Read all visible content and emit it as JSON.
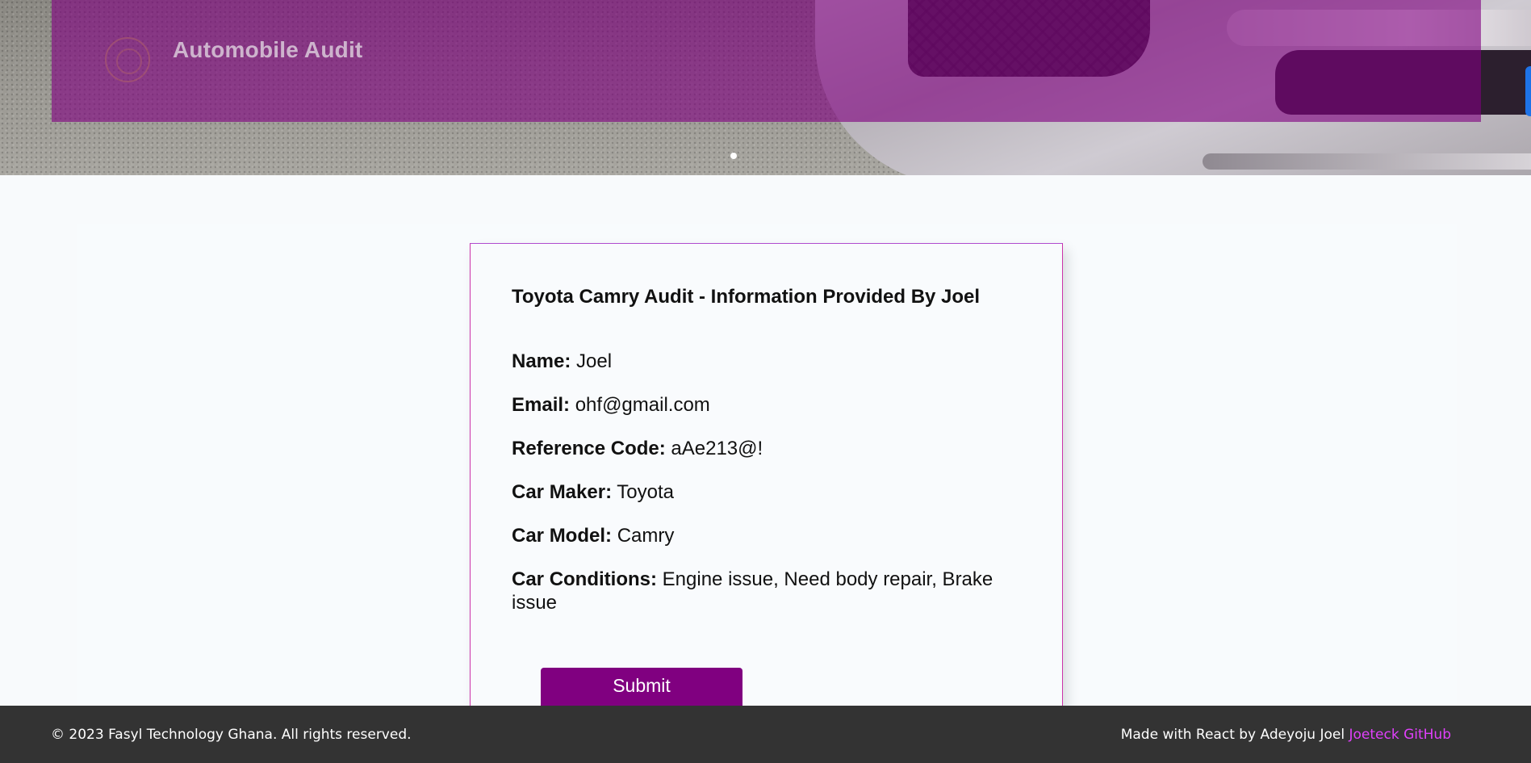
{
  "header": {
    "brand_title": "Automobile Audit",
    "logo_icon": "circle-logo-icon",
    "carousel": {
      "indicator_count": 1,
      "active_index": 0
    }
  },
  "audit_card": {
    "title": "Toyota Camry Audit - Information Provided By Joel",
    "fields": [
      {
        "label": "Name:",
        "value": "Joel"
      },
      {
        "label": "Email:",
        "value": "ohf@gmail.com"
      },
      {
        "label": "Reference Code:",
        "value": "aAe213@!"
      },
      {
        "label": "Car Maker:",
        "value": "Toyota"
      },
      {
        "label": "Car Model:",
        "value": "Camry"
      },
      {
        "label": "Car Conditions:",
        "value": "Engine issue, Need body repair, Brake issue"
      }
    ],
    "submit_label": "Submit"
  },
  "footer": {
    "copyright": "© 2023 Fasyl Technology Ghana. All rights reserved.",
    "made_with": "Made with React by Adeyoju Joel",
    "link_text": "Joeteck GitHub"
  },
  "colors": {
    "brand_purple": "#800080",
    "card_border": "#cc33aa",
    "footer_bg": "#333333",
    "footer_link": "#e040fb",
    "edge_button": "#1e73e8"
  }
}
